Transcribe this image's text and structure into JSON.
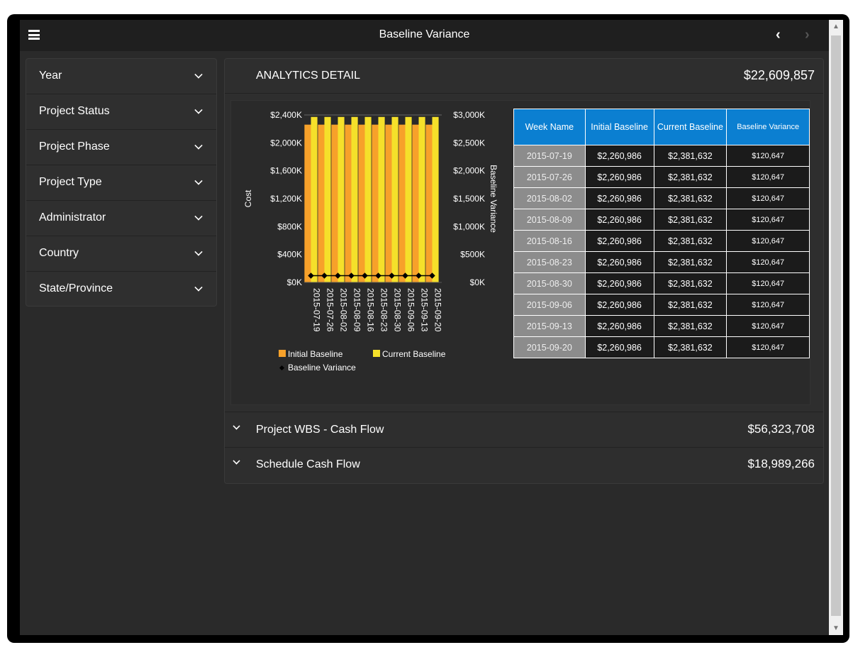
{
  "header": {
    "title": "Baseline Variance"
  },
  "filters": [
    "Year",
    "Project Status",
    "Project Phase",
    "Project Type",
    "Administrator",
    "Country",
    "State/Province"
  ],
  "analytics": {
    "title": "ANALYTICS DETAIL",
    "total": "$22,609,857"
  },
  "table": {
    "headers": [
      "Week Name",
      "Initial Baseline",
      "Current Baseline",
      "Baseline Variance"
    ],
    "rows": [
      [
        "2015-07-19",
        "$2,260,986",
        "$2,381,632",
        "$120,647"
      ],
      [
        "2015-07-26",
        "$2,260,986",
        "$2,381,632",
        "$120,647"
      ],
      [
        "2015-08-02",
        "$2,260,986",
        "$2,381,632",
        "$120,647"
      ],
      [
        "2015-08-09",
        "$2,260,986",
        "$2,381,632",
        "$120,647"
      ],
      [
        "2015-08-16",
        "$2,260,986",
        "$2,381,632",
        "$120,647"
      ],
      [
        "2015-08-23",
        "$2,260,986",
        "$2,381,632",
        "$120,647"
      ],
      [
        "2015-08-30",
        "$2,260,986",
        "$2,381,632",
        "$120,647"
      ],
      [
        "2015-09-06",
        "$2,260,986",
        "$2,381,632",
        "$120,647"
      ],
      [
        "2015-09-13",
        "$2,260,986",
        "$2,381,632",
        "$120,647"
      ],
      [
        "2015-09-20",
        "$2,260,986",
        "$2,381,632",
        "$120,647"
      ]
    ]
  },
  "sections": [
    {
      "label": "Project WBS - Cash Flow",
      "value": "$56,323,708"
    },
    {
      "label": "Schedule Cash Flow",
      "value": "$18,989,266"
    }
  ],
  "colors": {
    "initial": "#f7a12a",
    "current": "#f5e02a",
    "variance": "#000000",
    "header": "#0b7fd1"
  },
  "chart_data": {
    "type": "bar",
    "categories": [
      "2015-07-19",
      "2015-07-26",
      "2015-08-02",
      "2015-08-09",
      "2015-08-16",
      "2015-08-23",
      "2015-08-30",
      "2015-09-06",
      "2015-09-13",
      "2015-09-20"
    ],
    "series": [
      {
        "name": "Initial Baseline",
        "axis": "left",
        "values": [
          2260986,
          2260986,
          2260986,
          2260986,
          2260986,
          2260986,
          2260986,
          2260986,
          2260986,
          2260986
        ]
      },
      {
        "name": "Current Baseline",
        "axis": "left",
        "values": [
          2381632,
          2381632,
          2381632,
          2381632,
          2381632,
          2381632,
          2381632,
          2381632,
          2381632,
          2381632
        ]
      },
      {
        "name": "Baseline Variance",
        "axis": "right",
        "type": "line",
        "values": [
          120647,
          120647,
          120647,
          120647,
          120647,
          120647,
          120647,
          120647,
          120647,
          120647
        ]
      }
    ],
    "ylabel": "Cost",
    "ylabel_right": "Baseline Variance",
    "ylim": [
      0,
      2400000
    ],
    "ylim_right": [
      0,
      3000000
    ],
    "yticks": [
      "$0K",
      "$400K",
      "$800K",
      "$1,200K",
      "$1,600K",
      "$2,000K",
      "$2,400K"
    ],
    "yticks_right": [
      "$0K",
      "$500K",
      "$1,000K",
      "$1,500K",
      "$2,000K",
      "$2,500K",
      "$3,000K"
    ],
    "legend_position": "bottom"
  }
}
